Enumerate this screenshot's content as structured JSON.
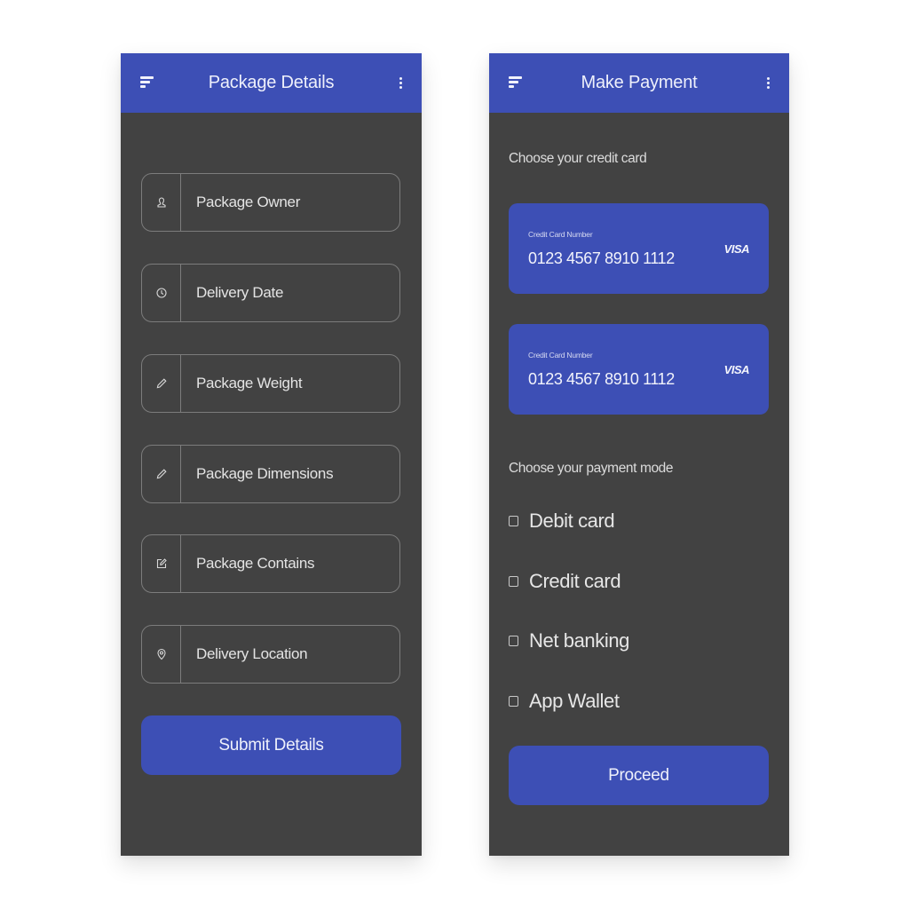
{
  "theme": {
    "accent": "#3d4fb5",
    "background": "#424242",
    "page": "#ffffff"
  },
  "package_screen": {
    "appbar": {
      "menu_icon": "menu-icon",
      "title": "Package Details",
      "more_icon": "more-vert-icon"
    },
    "fields": [
      {
        "label": "Package Owner",
        "icon": "person-icon"
      },
      {
        "label": "Delivery Date",
        "icon": "clock-icon"
      },
      {
        "label": "Package Weight",
        "icon": "pencil-icon"
      },
      {
        "label": "Package Dimensions",
        "icon": "pencil-icon"
      },
      {
        "label": "Package Contains",
        "icon": "edit-box-icon"
      },
      {
        "label": "Delivery Location",
        "icon": "location-pin-icon"
      }
    ],
    "submit_label": "Submit Details"
  },
  "payment_screen": {
    "appbar": {
      "menu_icon": "menu-icon",
      "title": "Make Payment",
      "more_icon": "more-vert-icon"
    },
    "choose_card_label": "Choose your credit card",
    "cards": [
      {
        "label": "Credit Card Number",
        "number": "0123 4567 8910 1112",
        "brand": "VISA"
      },
      {
        "label": "Credit Card Number",
        "number": "0123 4567 8910 1112",
        "brand": "VISA"
      }
    ],
    "choose_mode_label": "Choose your payment mode",
    "payment_modes": [
      {
        "label": "Debit card",
        "checked": false
      },
      {
        "label": "Credit card",
        "checked": false
      },
      {
        "label": "Net banking",
        "checked": false
      },
      {
        "label": "App Wallet",
        "checked": false
      }
    ],
    "proceed_label": "Proceed"
  }
}
